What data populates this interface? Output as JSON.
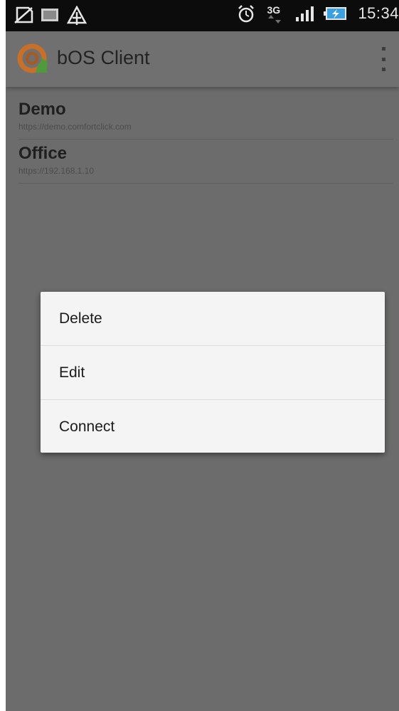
{
  "status_bar": {
    "time": "15:34",
    "network_type": "3G",
    "icons": [
      "no-sim-icon",
      "message-icon",
      "alert-icon",
      "alarm-icon",
      "3g-data-icon",
      "signal-icon",
      "battery-charging-icon"
    ]
  },
  "action_bar": {
    "title": "bOS Client",
    "logo": "bos-logo-icon",
    "overflow": "overflow-menu-icon"
  },
  "servers": [
    {
      "name": "Demo",
      "url": "https://demo.comfortclick.com"
    },
    {
      "name": "Office",
      "url": "https://192.168.1.10"
    }
  ],
  "context_menu": {
    "items": [
      {
        "label": "Delete"
      },
      {
        "label": "Edit"
      },
      {
        "label": "Connect"
      }
    ]
  },
  "colors": {
    "scrim": "#6b6c6b",
    "status_bar": "#0c0c0c",
    "menu_background": "#f4f4f4",
    "logo_orange": "#c8702a",
    "logo_green": "#4f9a3a",
    "battery_blue": "#3aa0e0"
  }
}
